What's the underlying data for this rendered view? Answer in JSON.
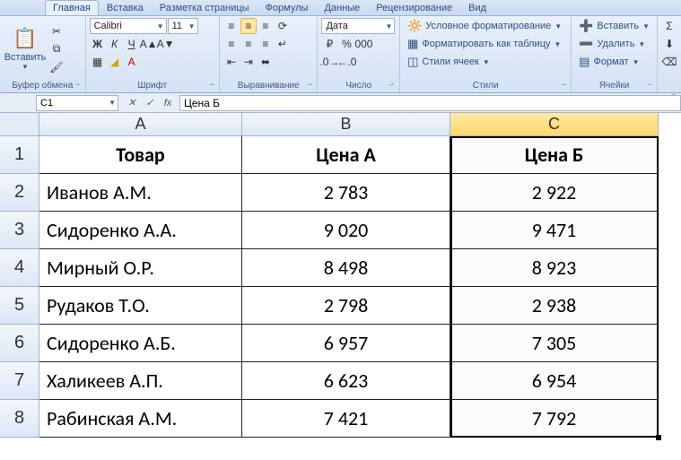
{
  "tabs": {
    "active": "Главная",
    "items": [
      "Главная",
      "Вставка",
      "Разметка страницы",
      "Формулы",
      "Данные",
      "Рецензирование",
      "Вид"
    ]
  },
  "ribbon": {
    "clipboard": {
      "label": "Буфер обмена",
      "paste": "Вставить"
    },
    "font": {
      "label": "Шрифт",
      "name": "Calibri",
      "size": "11",
      "bold": "Ж",
      "italic": "К",
      "underline": "Ч"
    },
    "alignment": {
      "label": "Выравнивание"
    },
    "number": {
      "label": "Число",
      "format": "Дата"
    },
    "styles": {
      "label": "Стили",
      "cond": "Условное форматирование",
      "table": "Форматировать как таблицу",
      "cell": "Стили ячеек"
    },
    "cells": {
      "label": "Ячейки",
      "insert": "Вставить",
      "delete": "Удалить",
      "format": "Формат"
    }
  },
  "formulaBar": {
    "nameBox": "C1",
    "fx": "fx",
    "value": "Цена Б"
  },
  "chart_data": {
    "type": "table",
    "columns": [
      "A",
      "B",
      "C"
    ],
    "headers": [
      "Товар",
      "Цена А",
      "Цена Б"
    ],
    "rows": [
      {
        "t": "Иванов А.М.",
        "a": "2 783",
        "b": "2 922"
      },
      {
        "t": "Сидоренко А.А.",
        "a": "9 020",
        "b": "9 471"
      },
      {
        "t": "Мирный О.Р.",
        "a": "8 498",
        "b": "8 923"
      },
      {
        "t": "Рудаков Т.О.",
        "a": "2 798",
        "b": "2 938"
      },
      {
        "t": "Сидоренко А.Б.",
        "a": "6 957",
        "b": "7 305"
      },
      {
        "t": "Халикеев А.П.",
        "a": "6 623",
        "b": "6 954"
      },
      {
        "t": "Рабинская А.М.",
        "a": "7 421",
        "b": "7 792"
      }
    ],
    "row_numbers": [
      "1",
      "2",
      "3",
      "4",
      "5",
      "6",
      "7",
      "8"
    ]
  }
}
